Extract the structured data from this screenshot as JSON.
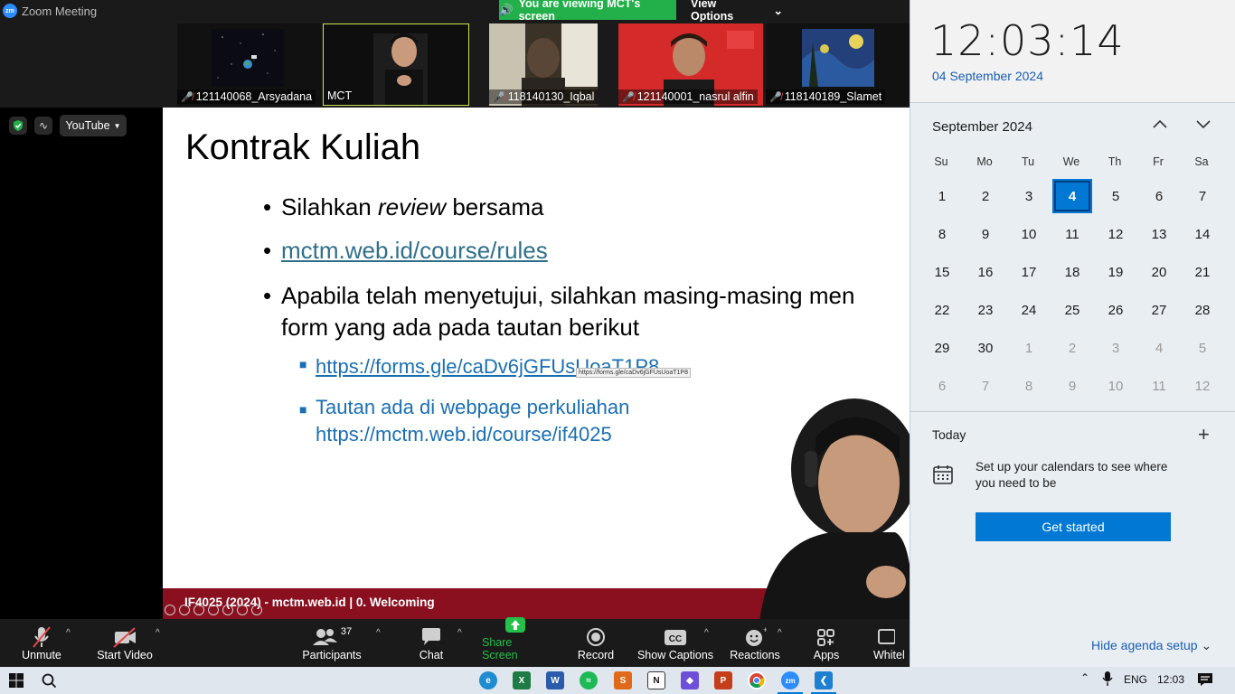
{
  "zoom": {
    "window_title": "Zoom Meeting",
    "share_banner": "You are viewing MCT's screen",
    "view_options": "View Options",
    "participants_strip": [
      {
        "name": "121140068_Arsyadana",
        "muted": true
      },
      {
        "name": "MCT",
        "muted": false
      },
      {
        "name": "118140130_Iqbal",
        "muted": true
      },
      {
        "name": "121140001_nasrul alfin",
        "muted": true
      },
      {
        "name": "118140189_Slamet",
        "muted": true
      }
    ],
    "side": {
      "youtube_label": "YouTube"
    },
    "toolbar": {
      "unmute": "Unmute",
      "start_video": "Start Video",
      "participants": "Participants",
      "participants_count": "37",
      "chat": "Chat",
      "share_screen": "Share Screen",
      "record": "Record",
      "show_captions": "Show Captions",
      "reactions": "Reactions",
      "apps": "Apps",
      "whiteboards": "Whitel"
    }
  },
  "slide": {
    "title": "Kontrak Kuliah",
    "bullet1_a": "Silahkan ",
    "bullet1_em": "review",
    "bullet1_b": " bersama",
    "bullet2_link": "mctm.web.id/course/rules",
    "bullet3_line1": "Apabila telah menyetujui, silahkan masing-masing men",
    "bullet3_line2": "form yang ada pada tautan berikut",
    "sub1_link": "https://forms.gle/caDv6jGFUsUoaT1P8",
    "tooltip": "https://forms.gle/caDv6jGFUsUoaT1P8",
    "sub2_line1": "Tautan ada di webpage perkuliahan",
    "sub2_line2": "https://mctm.web.id/course/if4025",
    "footer": "IF4025 (2024) - mctm.web.id | 0. Welcoming"
  },
  "calendar": {
    "time": "12:03:14",
    "date": "04 September 2024",
    "month_label": "September 2024",
    "weekdays": [
      "Su",
      "Mo",
      "Tu",
      "We",
      "Th",
      "Fr",
      "Sa"
    ],
    "weeks": [
      [
        "1",
        "2",
        "3",
        "4",
        "5",
        "6",
        "7"
      ],
      [
        "8",
        "9",
        "10",
        "11",
        "12",
        "13",
        "14"
      ],
      [
        "15",
        "16",
        "17",
        "18",
        "19",
        "20",
        "21"
      ],
      [
        "22",
        "23",
        "24",
        "25",
        "26",
        "27",
        "28"
      ],
      [
        "29",
        "30",
        "1",
        "2",
        "3",
        "4",
        "5"
      ],
      [
        "6",
        "7",
        "8",
        "9",
        "10",
        "11",
        "12"
      ]
    ],
    "today_label": "Today",
    "agenda_text": "Set up your calendars to see where you need to be",
    "get_started": "Get started",
    "hide_agenda": "Hide agenda setup"
  },
  "taskbar": {
    "language": "ENG",
    "clock": "12:03"
  },
  "colors": {
    "zoom_bg": "#1a1a1a",
    "share_green": "#23b04a",
    "slide_footer": "#8a1020",
    "windows_accent": "#0078d4"
  }
}
